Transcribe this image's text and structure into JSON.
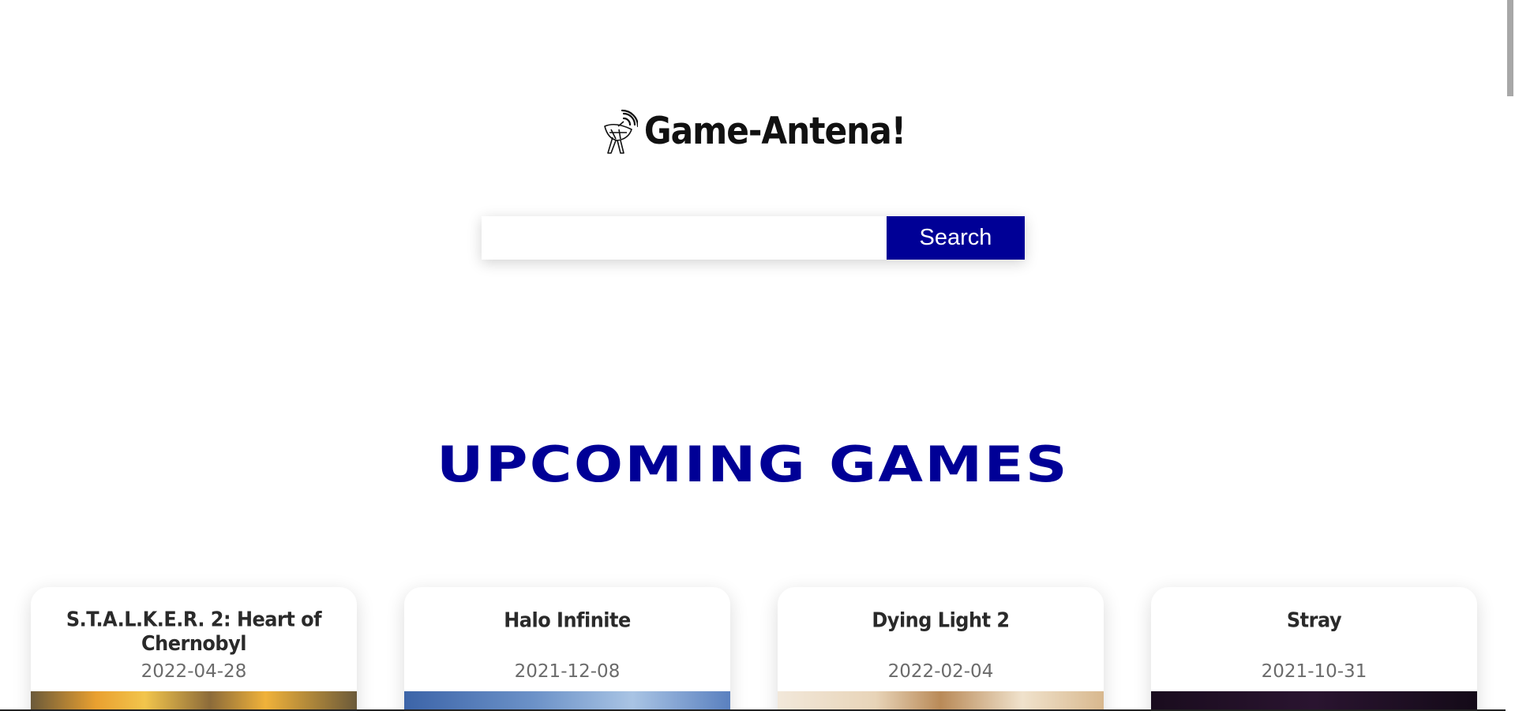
{
  "brand": {
    "title": "Game-Antena!",
    "icon": "satellite-dish-icon"
  },
  "search": {
    "placeholder": "",
    "value": "",
    "button_label": "Search"
  },
  "section": {
    "title": "UPCOMING GAMES"
  },
  "games": [
    {
      "title": "S.T.A.L.K.E.R. 2: Heart of Chernobyl",
      "date": "2022-04-28"
    },
    {
      "title": "Halo Infinite",
      "date": "2021-12-08"
    },
    {
      "title": "Dying Light 2",
      "date": "2022-02-04"
    },
    {
      "title": "Stray",
      "date": "2021-10-31"
    }
  ],
  "colors": {
    "accent": "#000096",
    "text": "#111111",
    "muted": "#6b6b6b"
  }
}
